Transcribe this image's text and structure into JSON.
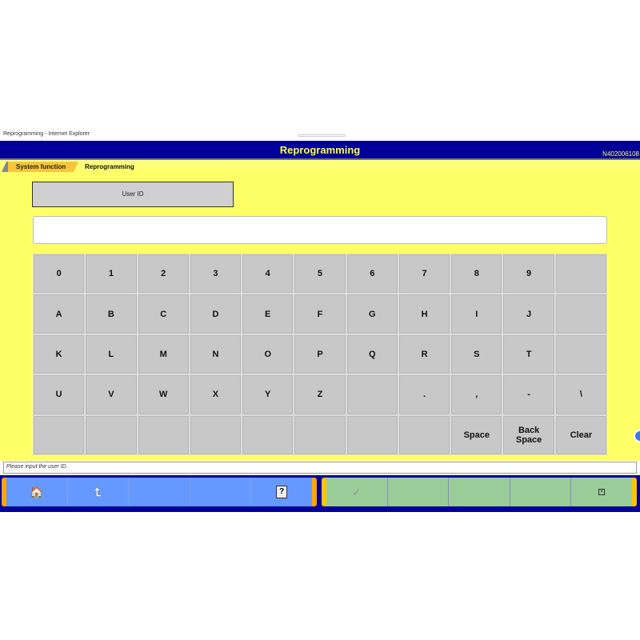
{
  "window": {
    "title": "Reprogramming - Internet Explorer"
  },
  "header": {
    "title": "Reprogramming",
    "code": "N402006108"
  },
  "breadcrumb": [
    "System function",
    "Reprogramming"
  ],
  "user_id_label": "User ID",
  "input": {
    "value": ""
  },
  "keyboard": {
    "rows": [
      [
        "0",
        "1",
        "2",
        "3",
        "4",
        "5",
        "6",
        "7",
        "8",
        "9",
        ""
      ],
      [
        "A",
        "B",
        "C",
        "D",
        "E",
        "F",
        "G",
        "H",
        "I",
        "J",
        ""
      ],
      [
        "K",
        "L",
        "M",
        "N",
        "O",
        "P",
        "Q",
        "R",
        "S",
        "T",
        ""
      ],
      [
        "U",
        "V",
        "W",
        "X",
        "Y",
        "Z",
        "",
        ".",
        ",",
        "-",
        "\\"
      ],
      [
        "",
        "",
        "",
        "",
        "",
        "",
        "",
        "",
        "Space",
        "Back Space",
        "Clear"
      ]
    ]
  },
  "status": "Please input the user ID.",
  "toolbar": {
    "left": [
      "home-icon",
      "back-icon",
      "",
      "",
      "help-icon"
    ],
    "right": [
      "check-icon",
      "",
      "",
      "",
      "close-icon"
    ]
  },
  "colors": {
    "header": "#000099",
    "title": "#ffff33",
    "content": "#ffff66",
    "left_buttons": "#6699ff",
    "right_buttons": "#99cc99"
  }
}
